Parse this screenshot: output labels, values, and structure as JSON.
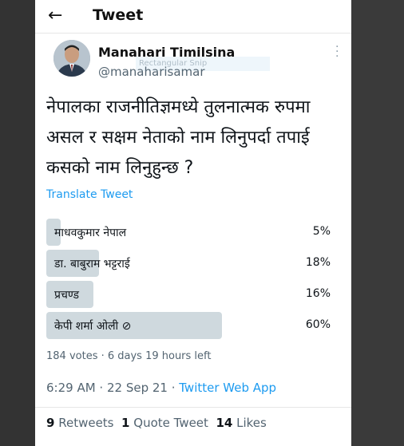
{
  "header": {
    "back_icon": "arrow-left-icon",
    "title": "Tweet"
  },
  "author": {
    "name": "Manahari Timilsina",
    "handle": "@manaharisamar",
    "overlay_text": "Rectangular Snip"
  },
  "tweet": {
    "text": "नेपालका राजनीतिज्ञमध्ये तुलनात्मक रुपमा असल र सक्षम नेताको नाम लिनुपर्दा तपाई कसको नाम लिनुहुन्छ ?",
    "translate_label": "Translate Tweet"
  },
  "poll": {
    "options": [
      {
        "label": "माधवकुमार नेपाल",
        "percent": "5%",
        "value": 5
      },
      {
        "label": "डा. बाबुराम भट्टराई",
        "percent": "18%",
        "value": 18
      },
      {
        "label": "प्रचण्ड",
        "percent": "16%",
        "value": 16
      },
      {
        "label": "केपी शर्मा ओली ⊘",
        "percent": "60%",
        "value": 60
      }
    ],
    "summary": "184 votes · 6 days 19 hours left",
    "bar_color": "#cfd9de"
  },
  "timestamp": {
    "time": "6:29 AM · 22 Sep 21 · ",
    "app": "Twitter Web App"
  },
  "stats": {
    "retweets_count": "9",
    "retweets_label": "Retweets",
    "quotes_count": "1",
    "quotes_label": "Quote Tweet",
    "likes_count": "14",
    "likes_label": "Likes"
  },
  "colors": {
    "link": "#1d9bf0",
    "secondary_text": "#536471"
  }
}
